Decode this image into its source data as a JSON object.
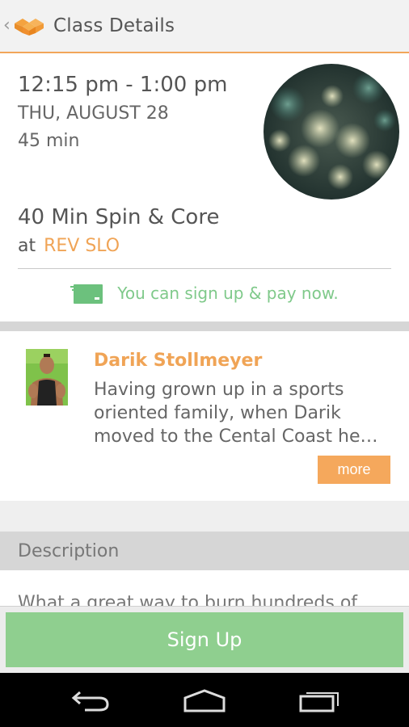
{
  "app_bar": {
    "title": "Class Details",
    "back_icon": "chevron-left-icon",
    "logo_icon": "app-logo-icon",
    "accent_color": "#f2a65a"
  },
  "class_info": {
    "time": "12:15 pm - 1:00 pm",
    "date": "THU, AUGUST 28",
    "duration": "45 min",
    "name": "40 Min Spin & Core",
    "at_label": "at",
    "venue": "REV SLO",
    "signup_note": "You can sign up & pay now.",
    "signup_note_icon": "credit-card-icon"
  },
  "instructor": {
    "name": "Darik Stollmeyer",
    "bio": "Having grown up in a sports oriented family, when Darik moved to the Cental Coast he…",
    "more_label": "more"
  },
  "description": {
    "header": "Description",
    "text": "What a great way to burn hundreds of"
  },
  "footer": {
    "signup_label": "Sign Up",
    "button_color": "#8fcf8f"
  },
  "nav_bar": {
    "icons": [
      "back-icon",
      "home-icon",
      "recent-apps-icon"
    ]
  }
}
